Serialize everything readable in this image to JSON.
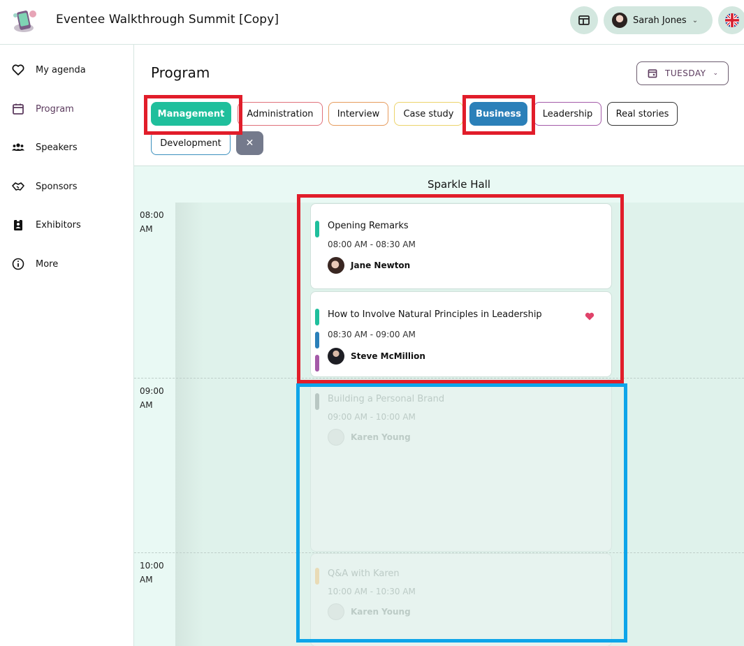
{
  "header": {
    "app_title": "Eventee Walkthrough Summit [Copy]",
    "user_name": "Sarah Jones",
    "icons": {
      "logo": "eventee-logo",
      "layout": "layout-icon",
      "user_menu": "chevron-down-icon",
      "language": "uk-flag-icon"
    }
  },
  "sidebar": {
    "items": [
      {
        "label": "My agenda",
        "icon": "heart-icon"
      },
      {
        "label": "Program",
        "icon": "calendar-icon",
        "active": true
      },
      {
        "label": "Speakers",
        "icon": "people-icon"
      },
      {
        "label": "Sponsors",
        "icon": "handshake-icon"
      },
      {
        "label": "Exhibitors",
        "icon": "badge-icon"
      },
      {
        "label": "More",
        "icon": "info-icon"
      }
    ]
  },
  "main": {
    "page_title": "Program",
    "day_selector": {
      "label": "TUESDAY",
      "icon": "calendar-icon"
    },
    "tags": [
      {
        "label": "Management",
        "color": "#1fbf9c",
        "selected": true
      },
      {
        "label": "Administration",
        "color": "#e0707a",
        "selected": false
      },
      {
        "label": "Interview",
        "color": "#e69b5c",
        "selected": false
      },
      {
        "label": "Case study",
        "color": "#ecd36a",
        "selected": false
      },
      {
        "label": "Business",
        "color": "#2b80b9",
        "selected": true
      },
      {
        "label": "Leadership",
        "color": "#a45aa8",
        "selected": false
      },
      {
        "label": "Real stories",
        "color": "#333333",
        "selected": false
      },
      {
        "label": "Development",
        "color": "#3b8fbd",
        "selected": false
      }
    ],
    "clear_filter": "✕"
  },
  "schedule": {
    "hall": "Sparkle Hall",
    "times": [
      {
        "line1": "08:00",
        "line2": "AM"
      },
      {
        "line1": "09:00",
        "line2": "AM"
      },
      {
        "line1": "10:00",
        "line2": "AM"
      }
    ],
    "sessions": [
      {
        "title": "Opening Remarks",
        "time": "08:00 AM - 08:30 AM",
        "speaker": "Jane Newton",
        "tag_colors": [
          "#1fbf9c"
        ],
        "favorite": false,
        "dimmed": false
      },
      {
        "title": "How to Involve Natural Principles in Leadership",
        "time": "08:30 AM - 09:00 AM",
        "speaker": "Steve McMillion",
        "tag_colors": [
          "#1fbf9c",
          "#2b80b9",
          "#a45aa8"
        ],
        "favorite": true,
        "dimmed": false
      },
      {
        "title": "Building a Personal Brand",
        "time": "09:00 AM - 10:00 AM",
        "speaker": "Karen Young",
        "tag_colors": [
          "#b9c7c3"
        ],
        "favorite": false,
        "dimmed": true
      },
      {
        "title": "Q&A with Karen",
        "time": "10:00 AM - 10:30 AM",
        "speaker": "Karen Young",
        "tag_colors": [
          "#e9dbb6"
        ],
        "favorite": false,
        "dimmed": true
      }
    ]
  }
}
